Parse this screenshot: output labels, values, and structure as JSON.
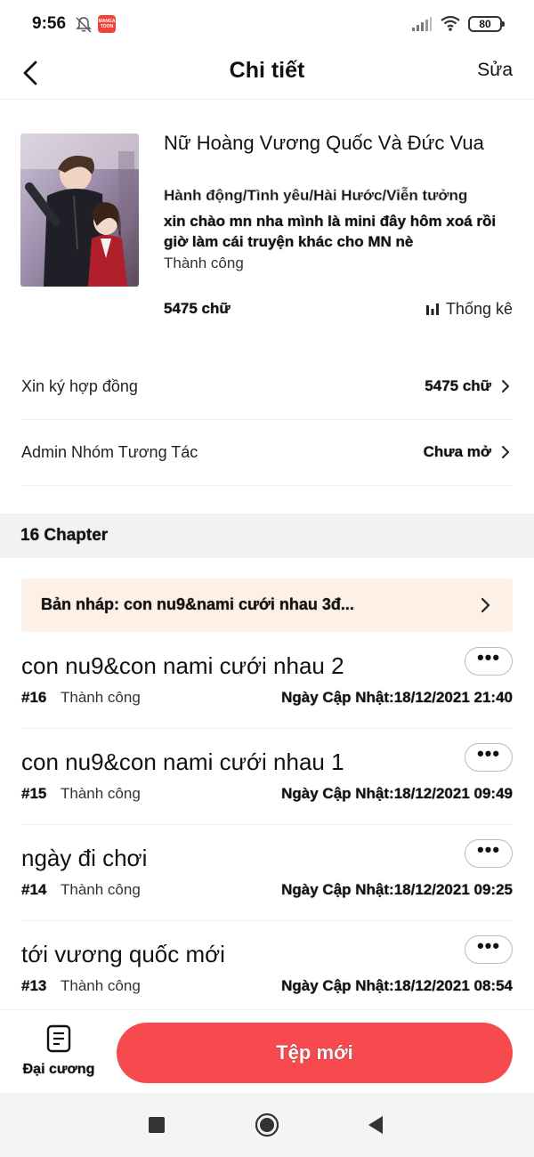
{
  "status_bar": {
    "time": "9:56",
    "app_badge": "MANGA TOON",
    "battery": "80"
  },
  "header": {
    "title": "Chi tiết",
    "edit_label": "Sửa",
    "back_icon": "chevron-left-icon"
  },
  "novel": {
    "title": "Nữ Hoàng Vương Quốc Và Đức Vua",
    "genres": "Hành động/Tình yêu/Hài Hước/Viễn tưởng",
    "description": "xin chào mn nha mình là mini đây hôm xoá rồi giờ làm cái truyện khác cho MN nè",
    "status": "Thành công",
    "word_count": "5475 chữ",
    "stats_label": "Thống kê"
  },
  "settings": [
    {
      "label": "Xin ký hợp đồng",
      "value": "5475 chữ"
    },
    {
      "label": "Admin Nhóm Tương Tác",
      "value": "Chưa mở"
    }
  ],
  "chapters_section": {
    "label": "16 Chapter"
  },
  "draft": {
    "text": "Bản nháp: con nu9&nami cưới nhau 3đ..."
  },
  "chapters": [
    {
      "title": "con nu9&con nami cưới nhau 2",
      "number": "#16",
      "status": "Thành công",
      "updated": "Ngày Cập Nhật:18/12/2021 21:40"
    },
    {
      "title": "con nu9&con nami cưới nhau 1",
      "number": "#15",
      "status": "Thành công",
      "updated": "Ngày Cập Nhật:18/12/2021 09:49"
    },
    {
      "title": "ngày đi chơi",
      "number": "#14",
      "status": "Thành công",
      "updated": "Ngày Cập Nhật:18/12/2021 09:25"
    },
    {
      "title": "tới vương quốc mới",
      "number": "#13",
      "status": "Thành công",
      "updated": "Ngày Cập Nhật:18/12/2021 08:54"
    }
  ],
  "bottom_bar": {
    "outline_label": "Đại cương",
    "new_file_label": "Tệp mới"
  },
  "more_label": "•••",
  "colors": {
    "accent": "#f64a4f",
    "draft_bg": "#fdf0e6",
    "section_bg": "#f2f2f2"
  }
}
